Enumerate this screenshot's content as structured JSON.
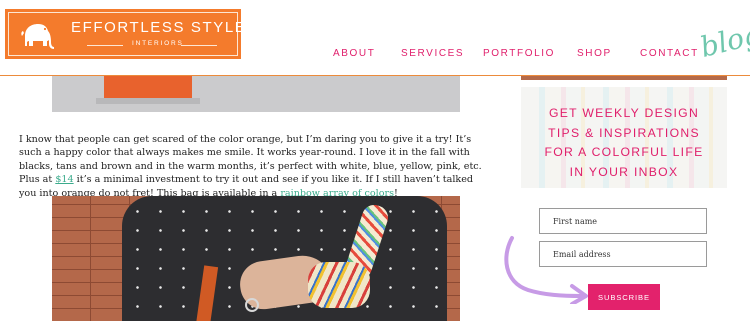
{
  "brand": {
    "title": "EFFORTLESS STYLE",
    "subtitle": "INTERIORS",
    "logo_bg": "#f47b2c",
    "logo_icon": "elephant-icon"
  },
  "nav": {
    "items": [
      {
        "label": "ABOUT"
      },
      {
        "label": "SERVICES"
      },
      {
        "label": "PORTFOLIO"
      },
      {
        "label": "SHOP"
      },
      {
        "label": "CONTACT"
      }
    ],
    "color": "#e0206c"
  },
  "blog_label": "blog",
  "article": {
    "p_part1": "I know that people can get scared of the color orange, but I’m daring you to give it a try! It’s such a happy color that always makes me smile. It works year-round. I love it in the fall with blacks, tans and brown and in the warm months, it’s perfect with white, blue, yellow, pink, etc. Plus at ",
    "price_link": "$14",
    "p_part2": " it’s a minimal investment to try it out and see if you like it. If I still haven’t talked you into orange do not fret! This bag is available in a ",
    "colors_link": "rainbow array of colors",
    "p_part3": "!",
    "link_color": "#3bab8c"
  },
  "sidebar": {
    "promo_lines": [
      "GET WEEKLY DESIGN",
      "TIPS & INSPIRATIONS",
      "FOR A COLORFUL LIFE",
      "IN YOUR INBOX"
    ],
    "form": {
      "first_name_placeholder": "First name",
      "email_placeholder": "Email address",
      "subscribe_label": "SUBSCRIBE"
    },
    "accent": "#e3226c",
    "arrow_color": "#c79be6"
  }
}
